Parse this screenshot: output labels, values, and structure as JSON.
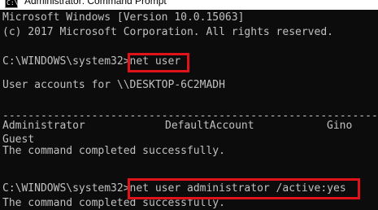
{
  "window": {
    "title": "Administrator: Command Prompt",
    "icon": "cmd-icon",
    "icon_glyph": "C:\\"
  },
  "console": {
    "header_line1": "Microsoft Windows [Version 10.0.15063]",
    "header_line2": "(c) 2017 Microsoft Corporation. All rights reserved.",
    "prompt": "C:\\WINDOWS\\system32>",
    "command1": "net user",
    "accounts_header": "User accounts for \\\\DESKTOP-6C2MADH",
    "separator": "-------------------------------------------------------------------------------",
    "accounts": [
      "Administrator",
      "DefaultAccount",
      "Gino",
      "Guest"
    ],
    "success_message": "The command completed successfully.",
    "command2": "net user administrator /active:yes",
    "success_message_2": "The command completed successfully."
  },
  "colors": {
    "background": "#0c0c0c",
    "text": "#c0c0c0",
    "highlight": "#e0131a"
  }
}
